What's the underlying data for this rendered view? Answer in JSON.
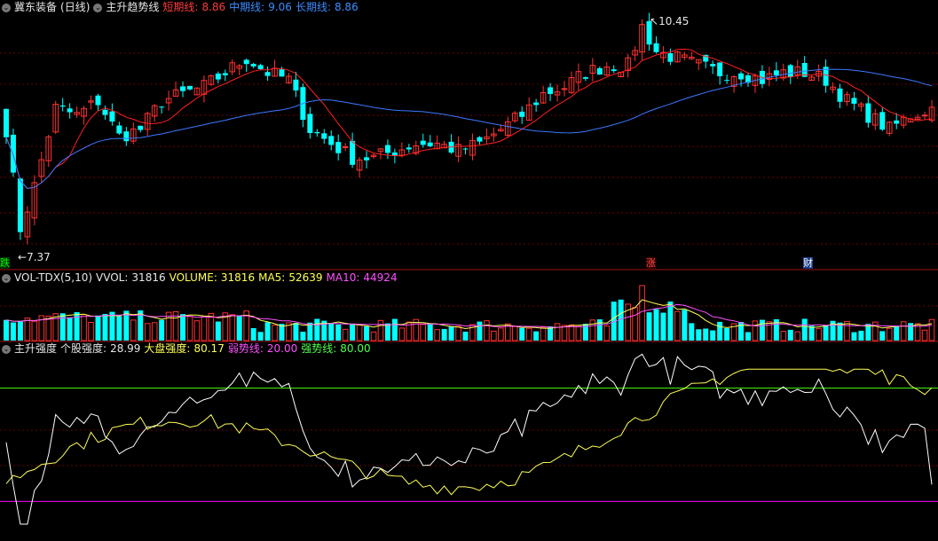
{
  "header_main": {
    "stock_name": "冀东装备",
    "period": "(日线)",
    "indicator": "主升趋势线",
    "short_label": "短期线:",
    "short_value": "8.86",
    "mid_label": "中期线:",
    "mid_value": "9.06",
    "long_label": "长期线:",
    "long_value": "8.86"
  },
  "header_vol": {
    "indicator": "VOL-TDX(5,10)",
    "vvol_label": "VVOL:",
    "vvol_value": "31816",
    "volume_label": "VOLUME:",
    "volume_value": "31816",
    "ma5_label": "MA5:",
    "ma5_value": "52639",
    "ma10_label": "MA10:",
    "ma10_value": "44924"
  },
  "header_strength": {
    "indicator": "主升强度",
    "stock_label": "个股强度:",
    "stock_value": "28.99",
    "market_label": "大盘强度:",
    "market_value": "80.17",
    "weak_label": "弱势线:",
    "weak_value": "20.00",
    "strong_label": "强势线:",
    "strong_value": "80.00"
  },
  "annotations": {
    "high": "10.45",
    "low": "7.37",
    "marker_left": "跌",
    "marker_mid": "涨",
    "marker_right": "财"
  },
  "colors": {
    "up": "#ff3232",
    "down": "#00ffff",
    "short_ma": "#ff2020",
    "long_ma": "#3c78ff",
    "stock_strength": "#ffffff",
    "market_strength": "#ffff55",
    "weak_line": "#ff00ff",
    "strong_line": "#44ff00"
  },
  "chart_data": {
    "type": "candlestick",
    "price_anchor_points": [
      [
        0,
        9.0
      ],
      [
        2,
        7.6
      ],
      [
        4,
        8.2
      ],
      [
        7,
        9.3
      ],
      [
        10,
        9.2
      ],
      [
        13,
        9.4
      ],
      [
        16,
        8.9
      ],
      [
        19,
        9.0
      ],
      [
        22,
        9.4
      ],
      [
        25,
        9.5
      ],
      [
        28,
        9.6
      ],
      [
        31,
        9.8
      ],
      [
        34,
        10.0
      ],
      [
        37,
        9.8
      ],
      [
        40,
        9.7
      ],
      [
        43,
        9.0
      ],
      [
        46,
        8.8
      ],
      [
        49,
        8.6
      ],
      [
        52,
        8.6
      ],
      [
        55,
        8.7
      ],
      [
        58,
        8.8
      ],
      [
        61,
        8.8
      ],
      [
        64,
        8.7
      ],
      [
        67,
        8.8
      ],
      [
        70,
        9.0
      ],
      [
        73,
        9.2
      ],
      [
        76,
        9.5
      ],
      [
        79,
        9.6
      ],
      [
        82,
        9.8
      ],
      [
        85,
        9.9
      ],
      [
        88,
        9.9
      ],
      [
        90,
        10.45
      ],
      [
        92,
        10.1
      ],
      [
        95,
        10.0
      ],
      [
        98,
        9.9
      ],
      [
        101,
        9.8
      ],
      [
        104,
        9.8
      ],
      [
        107,
        9.7
      ],
      [
        110,
        9.8
      ],
      [
        113,
        9.8
      ],
      [
        116,
        9.7
      ],
      [
        119,
        9.4
      ],
      [
        122,
        9.2
      ],
      [
        125,
        9.0
      ],
      [
        128,
        9.2
      ],
      [
        131,
        9.3
      ]
    ],
    "price_high": 10.45,
    "price_low": 7.37,
    "volume_ma5": 52639,
    "volume_ma10": 44924,
    "strength_weak_line": 20.0,
    "strength_strong_line": 80.0,
    "stock_strength_last": 28.99,
    "market_strength_last": 80.17
  }
}
